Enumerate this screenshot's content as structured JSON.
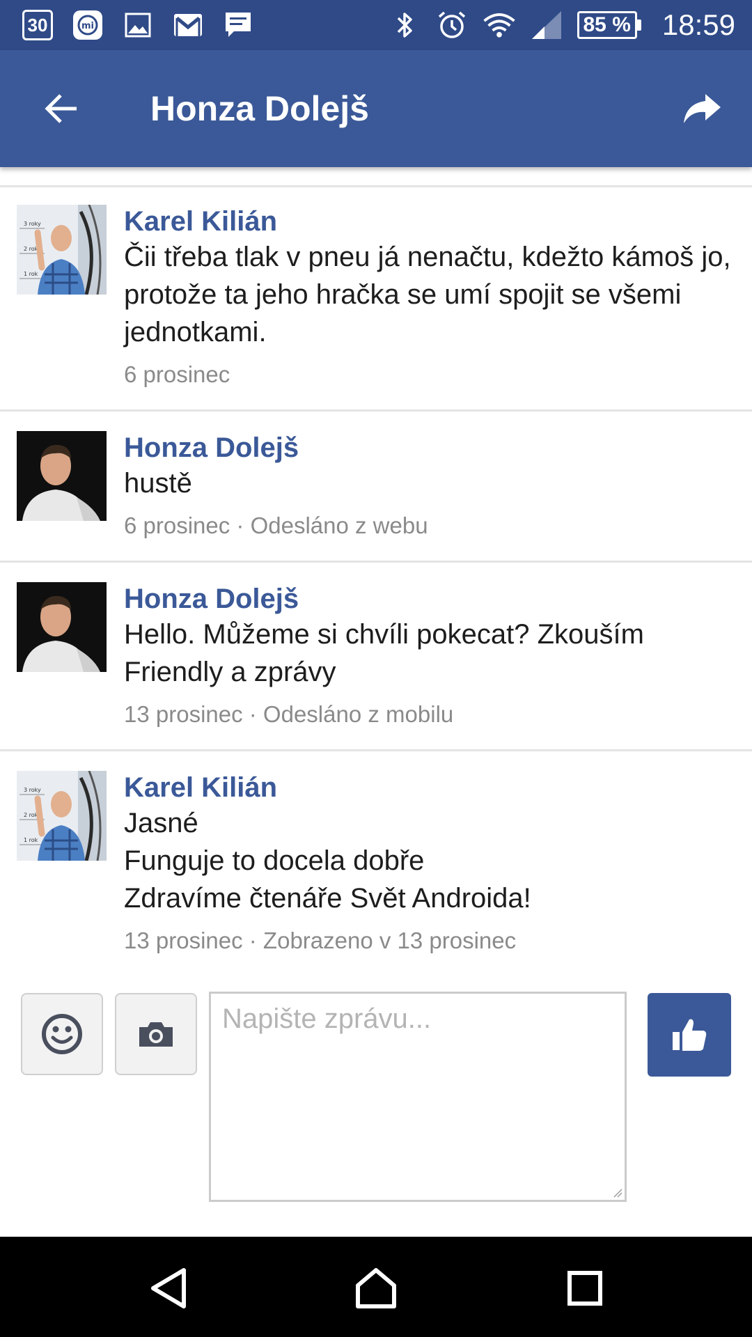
{
  "status_bar": {
    "calendar_day": "30",
    "battery_percent": "85 %",
    "time": "18:59",
    "left_icons": [
      "calendar-icon",
      "mi-icon",
      "gallery-icon",
      "gmail-icon",
      "message-icon"
    ],
    "right_icons": [
      "bluetooth-icon",
      "alarm-icon",
      "wifi-icon",
      "signal-icon",
      "battery-icon"
    ],
    "mi_label": "mi"
  },
  "app_bar": {
    "title": "Honza Dolejš",
    "back_icon": "arrow-back-icon",
    "share_icon": "share-icon"
  },
  "messages": [
    {
      "sender": "Karel Kilián",
      "lines": [
        "Čii třeba tlak v pneu já nenačtu, kdežto kámoš jo, protože ta jeho hračka se umí spojit se všemi jednotkami."
      ],
      "meta": "6 prosinec",
      "avatar": "karel"
    },
    {
      "sender": "Honza Dolejš",
      "lines": [
        "hustě"
      ],
      "meta": "6 prosinec · Odesláno z webu",
      "avatar": "honza"
    },
    {
      "sender": "Honza Dolejš",
      "lines": [
        "Hello. Můžeme si chvíli pokecat? Zkouším Friendly a zprávy"
      ],
      "meta": "13 prosinec · Odesláno z mobilu",
      "avatar": "honza"
    },
    {
      "sender": "Karel Kilián",
      "lines": [
        "Jasné",
        "Funguje to docela dobře",
        "Zdravíme čtenáře Svět Androida!"
      ],
      "meta": "13 prosinec · Zobrazeno v 13 prosinec",
      "avatar": "karel"
    }
  ],
  "composer": {
    "placeholder": "Napište zprávu...",
    "emoji_icon": "emoji-icon",
    "camera_icon": "camera-icon",
    "like_icon": "thumbs-up-icon"
  },
  "nav_bar": {
    "icons": [
      "nav-back-icon",
      "nav-home-icon",
      "nav-recents-icon"
    ]
  },
  "colors": {
    "status_bar": "#2f4a87",
    "app_bar": "#3b5998",
    "sender": "#3b5998",
    "meta": "#8a8a8a",
    "divider": "#e4e4e4"
  }
}
